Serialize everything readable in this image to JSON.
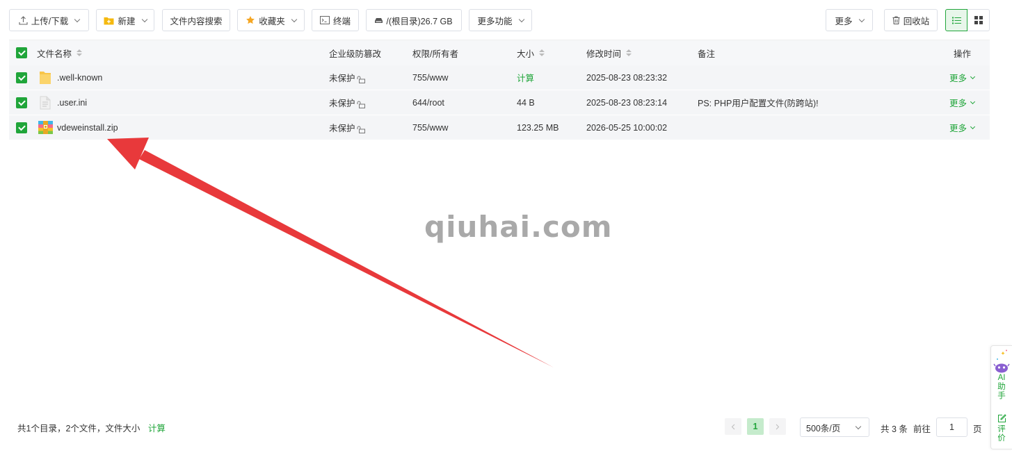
{
  "toolbar": {
    "upload_download": "上传/下载",
    "new": "新建",
    "content_search": "文件内容搜索",
    "favorites": "收藏夹",
    "terminal": "终端",
    "disk": "/(根目录)26.7 GB",
    "more_functions": "更多功能",
    "more": "更多",
    "recycle_bin": "回收站"
  },
  "table": {
    "headers": {
      "name": "文件名称",
      "tamper": "企业级防篡改",
      "perm_owner": "权限/所有者",
      "size": "大小",
      "mtime": "修改时间",
      "remark": "备注",
      "action": "操作"
    },
    "rows": [
      {
        "name": ".well-known",
        "icon": "folder-icon",
        "tamper": "未保护",
        "perm": "755/www",
        "size": "计算",
        "mtime": "2025-08-23 08:23:32",
        "remark": "",
        "action": "更多"
      },
      {
        "name": ".user.ini",
        "icon": "file-icon",
        "tamper": "未保护",
        "perm": "644/root",
        "size": "44 B",
        "mtime": "2025-08-23 08:23:14",
        "remark": "PS: PHP用户配置文件(防跨站)!",
        "action": "更多"
      },
      {
        "name": "vdeweinstall.zip",
        "icon": "zip-icon",
        "tamper": "未保护",
        "perm": "755/www",
        "size": "123.25 MB",
        "mtime": "2026-05-25 10:00:02",
        "remark": "",
        "action": "更多"
      }
    ]
  },
  "watermark": "qiuhai.com",
  "footer": {
    "summary": "共1个目录，2个文件，文件大小",
    "calc": "计算"
  },
  "pagination": {
    "current_page": "1",
    "page_size": "500条/页",
    "total": "共 3 条",
    "goto_label": "前往",
    "goto_value": "1",
    "page_unit": "页"
  },
  "side": {
    "ai_label": "AI助手",
    "rate_label": "评价"
  },
  "colors": {
    "accent": "#20a53a",
    "arrow": "#e8393b"
  }
}
